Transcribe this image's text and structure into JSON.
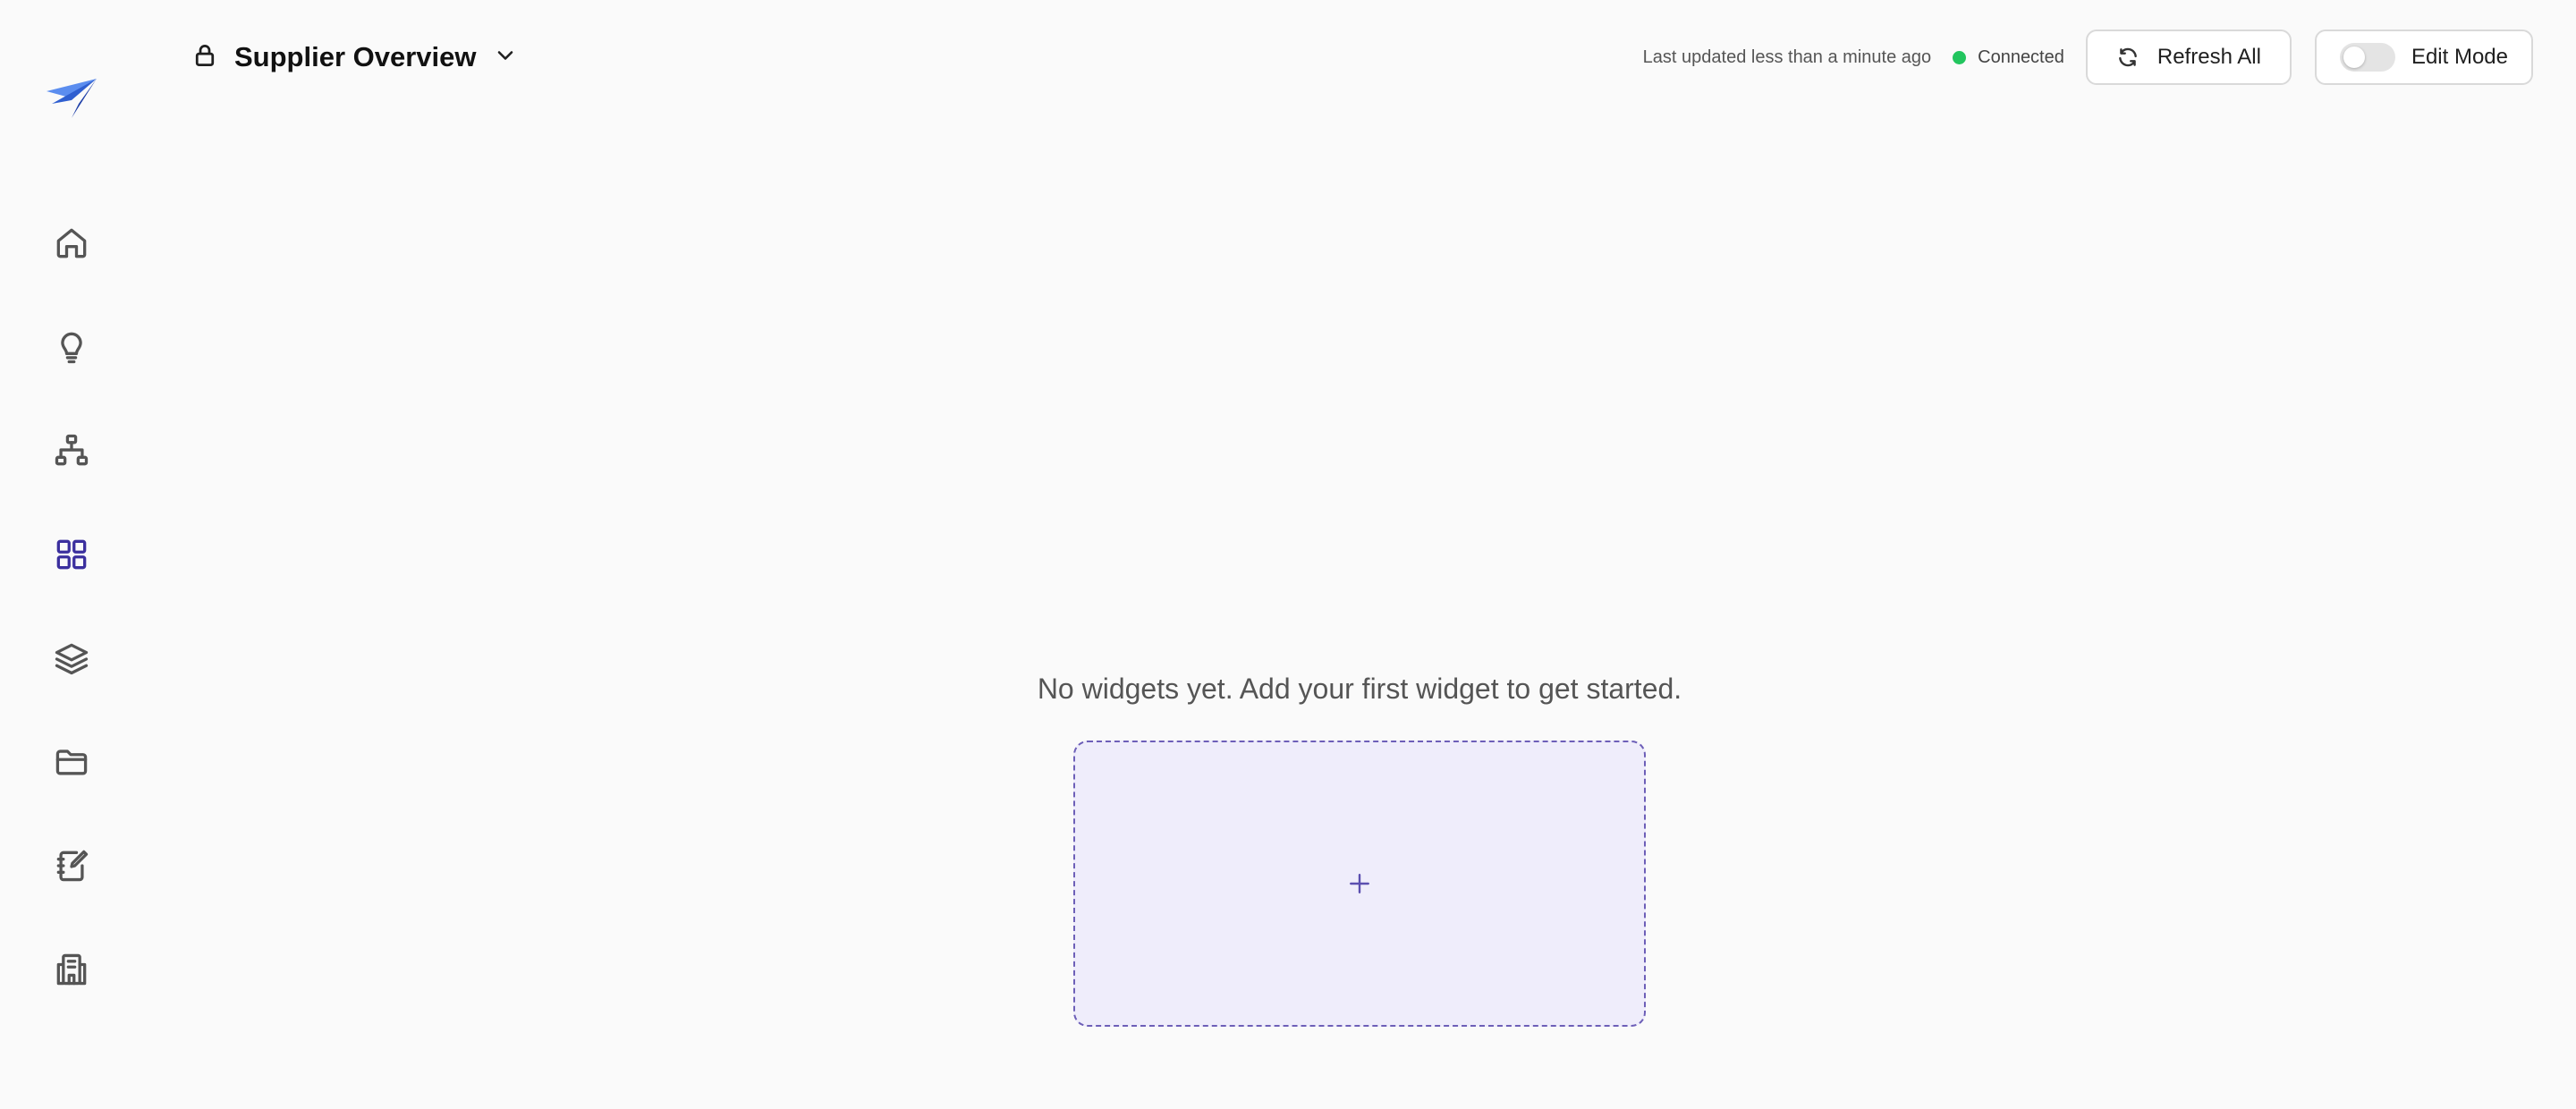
{
  "header": {
    "title": "Supplier Overview",
    "last_updated": "Last updated less than a minute ago",
    "status": "Connected",
    "status_color": "#22c55e",
    "refresh_label": "Refresh All",
    "edit_mode_label": "Edit Mode",
    "edit_mode_on": false
  },
  "sidebar": {
    "items": [
      {
        "icon": "home-icon",
        "active": false
      },
      {
        "icon": "lightbulb-icon",
        "active": false
      },
      {
        "icon": "hierarchy-icon",
        "active": false
      },
      {
        "icon": "grid-icon",
        "active": true
      },
      {
        "icon": "layers-icon",
        "active": false
      },
      {
        "icon": "folder-icon",
        "active": false
      },
      {
        "icon": "notebook-edit-icon",
        "active": false
      },
      {
        "icon": "building-icon",
        "active": false
      }
    ],
    "active_color": "#3b2f9e"
  },
  "main": {
    "empty_message": "No widgets yet. Add your first widget to get started.",
    "add_widget_icon": "plus-icon",
    "accent": "#6d5fb8"
  }
}
